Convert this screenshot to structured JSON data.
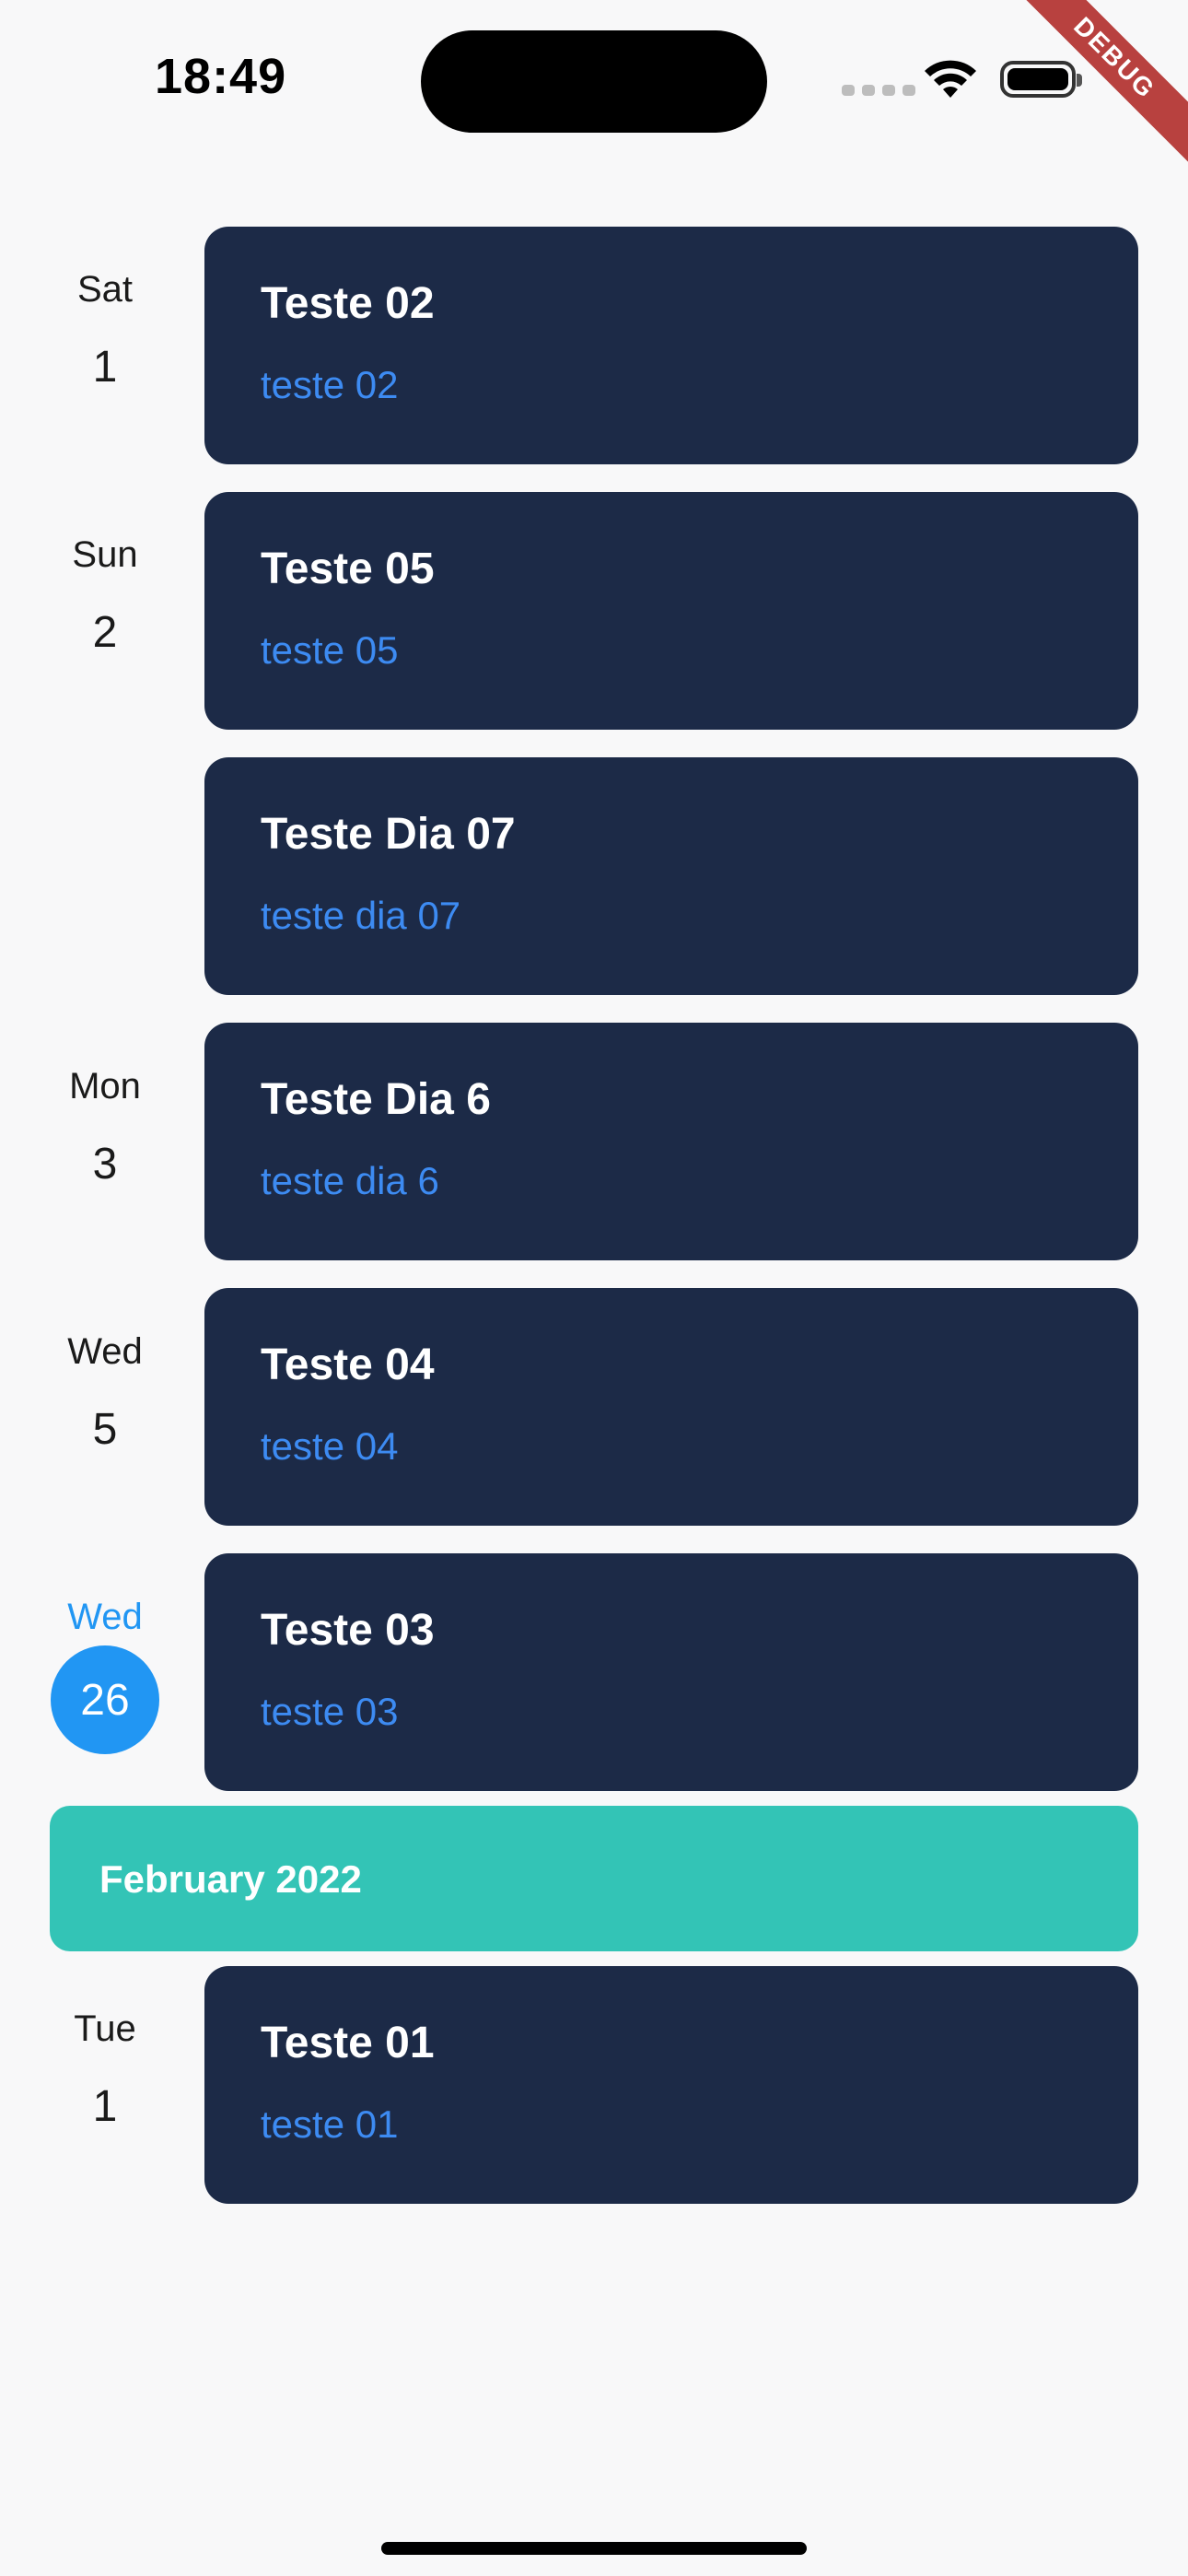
{
  "status_bar": {
    "time": "18:49"
  },
  "debug_banner": "DEBUG",
  "days": [
    {
      "weekday": "Sat",
      "day": "1"
    },
    {
      "weekday": "Sun",
      "day": "2"
    },
    {
      "weekday": "Mon",
      "day": "3"
    },
    {
      "weekday": "Wed",
      "day": "5"
    },
    {
      "weekday": "Wed",
      "day": "26",
      "today": true
    },
    {
      "weekday": "Tue",
      "day": "1"
    }
  ],
  "events": [
    {
      "title": "Teste 02",
      "subtitle": "teste 02"
    },
    {
      "title": "Teste 05",
      "subtitle": "teste 05"
    },
    {
      "title": "Teste Dia 07",
      "subtitle": "teste dia 07"
    },
    {
      "title": "Teste Dia 6",
      "subtitle": "teste dia 6"
    },
    {
      "title": "Teste 04",
      "subtitle": "teste 04"
    },
    {
      "title": "Teste 03",
      "subtitle": "teste 03"
    },
    {
      "title": "Teste 01",
      "subtitle": "teste 01"
    }
  ],
  "month_header": "February 2022",
  "colors": {
    "card_bg": "#1c2a47",
    "card_title": "#ffffff",
    "card_subtitle": "#3d8bf2",
    "today_accent": "#2196f3",
    "month_banner": "#33c4b6",
    "debug_ribbon": "#b8413f"
  }
}
